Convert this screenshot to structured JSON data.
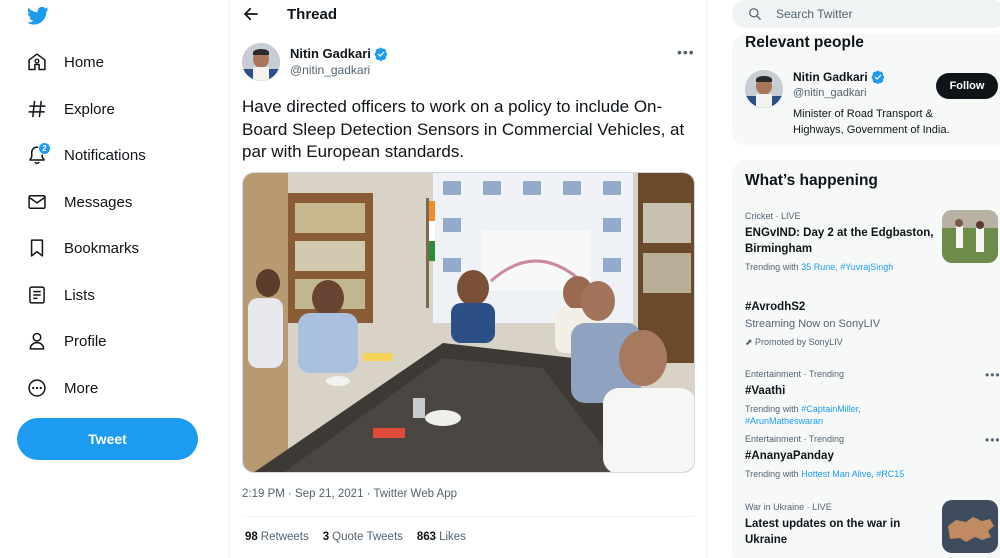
{
  "nav": {
    "items": [
      {
        "label": "Home"
      },
      {
        "label": "Explore"
      },
      {
        "label": "Notifications",
        "badge": "2"
      },
      {
        "label": "Messages"
      },
      {
        "label": "Bookmarks"
      },
      {
        "label": "Lists"
      },
      {
        "label": "Profile"
      },
      {
        "label": "More"
      }
    ],
    "tweet_button": "Tweet"
  },
  "thread": {
    "title": "Thread",
    "author": {
      "name": "Nitin Gadkari",
      "handle": "@nitin_gadkari"
    },
    "text": "Have directed officers to work on a policy to include On-Board Sleep Detection Sensors in Commercial Vehicles, at par with European standards.",
    "meta": "2:19 PM · Sep 21, 2021 · Twitter Web App",
    "stats": [
      {
        "count": "98",
        "label": "Retweets"
      },
      {
        "count": "3",
        "label": "Quote Tweets"
      },
      {
        "count": "863",
        "label": "Likes"
      }
    ]
  },
  "search": {
    "placeholder": "Search Twitter"
  },
  "relevant": {
    "title": "Relevant people",
    "name": "Nitin Gadkari",
    "handle": "@nitin_gadkari",
    "bio": "Minister of Road Transport & Highways, Government of India.",
    "follow": "Follow"
  },
  "happening": {
    "title": "What’s happening",
    "trends": [
      {
        "category": "Cricket · LIVE",
        "title": "ENGvIND: Day 2 at the Edgbaston, Birmingham",
        "sub_prefix": "Trending with ",
        "sub_links": "35 Rune, #YuvrajSingh"
      },
      {
        "category": "",
        "title": "#AvrodhS2",
        "stream": "Streaming Now on SonyLIV",
        "promoted": "Promoted by SonyLIV"
      },
      {
        "category": "Entertainment · Trending",
        "title": "#Vaathi",
        "sub_prefix": "Trending with ",
        "sub_links": "#CaptainMiller, #ArunMatheswaran"
      },
      {
        "category": "Entertainment · Trending",
        "title": "#AnanyaPanday",
        "sub_prefix": "Trending with ",
        "sub_links": "Hottest Man Alive, #RC15"
      },
      {
        "category": "War in Ukraine · LIVE",
        "title": "Latest updates on the war in Ukraine"
      }
    ]
  },
  "colors": {
    "accent": "#1d9bf0",
    "text": "#0f1419",
    "muted": "#536471"
  }
}
